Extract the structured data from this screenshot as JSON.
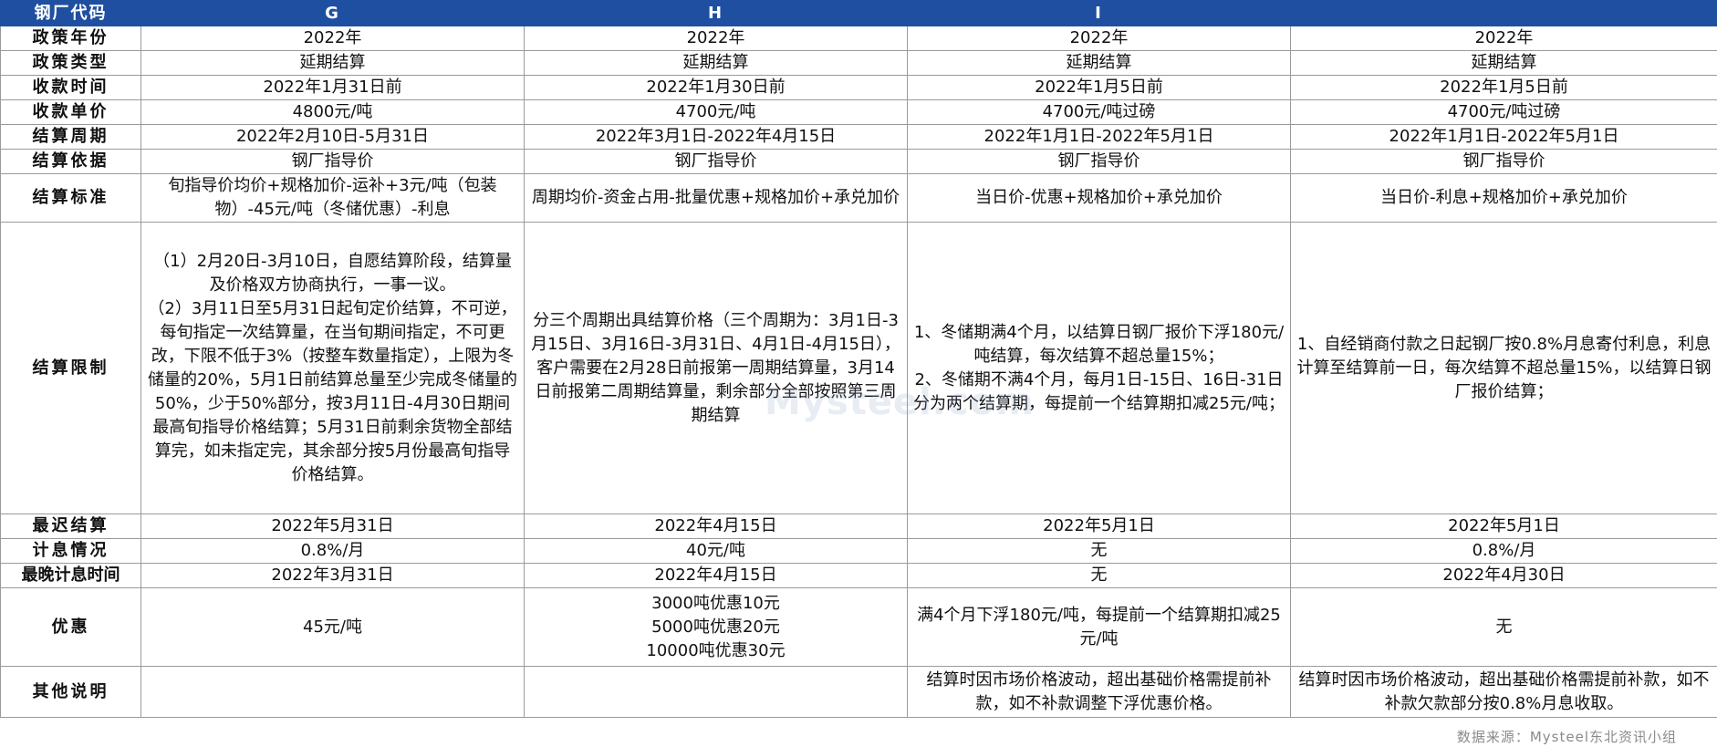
{
  "table": {
    "header": [
      "钢厂代码",
      "G",
      "H",
      "I",
      ""
    ],
    "rows": [
      {
        "label": "政策年份",
        "cells": [
          "2022年",
          "2022年",
          "2022年",
          "2022年"
        ]
      },
      {
        "label": "政策类型",
        "cells": [
          "延期结算",
          "延期结算",
          "延期结算",
          "延期结算"
        ]
      },
      {
        "label": "收款时间",
        "cells": [
          "2022年1月31日前",
          "2022年1月30日前",
          "2022年1月5日前",
          "2022年1月5日前"
        ]
      },
      {
        "label": "收款单价",
        "cells": [
          "4800元/吨",
          "4700元/吨",
          "4700元/吨过磅",
          "4700元/吨过磅"
        ]
      },
      {
        "label": "结算周期",
        "cells": [
          "2022年2月10日-5月31日",
          "2022年3月1日-2022年4月15日",
          "2022年1月1日-2022年5月1日",
          "2022年1月1日-2022年5月1日"
        ]
      },
      {
        "label": "结算依据",
        "cells": [
          "钢厂指导价",
          "钢厂指导价",
          "钢厂指导价",
          "钢厂指导价"
        ]
      },
      {
        "label": "结算标准",
        "cells": [
          "旬指导价均价+规格加价-运补+3元/吨（包装物）-45元/吨（冬储优惠）-利息",
          "周期均价-资金占用-批量优惠+规格加价+承兑加价",
          "当日价-优惠+规格加价+承兑加价",
          "当日价-利息+规格加价+承兑加价"
        ]
      },
      {
        "label": "结算限制",
        "cells": [
          "（1）2月20日-3月10日，自愿结算阶段，结算量及价格双方协商执行，一事一议。\n（2）3月11日至5月31日起旬定价结算，不可逆，每旬指定一次结算量，在当旬期间指定，不可更改，下限不低于3%（按整车数量指定），上限为冬储量的20%，5月1日前结算总量至少完成冬储量的50%，少于50%部分，按3月11日-4月30日期间最高旬指导价格结算；5月31日前剩余货物全部结算完，如未指定完，其余部分按5月份最高旬指导价格结算。",
          "分三个周期出具结算价格（三个周期为：3月1日-3月15日、3月16日-3月31日、4月1日-4月15日），客户需要在2月28日前报第一周期结算量，3月14日前报第二周期结算量，剩余部分全部按照第三周期结算",
          "1、冬储期满4个月，以结算日钢厂报价下浮180元/吨结算，每次结算不超总量15%；\n2、冬储期不满4个月，每月1日-15日、16日-31日分为两个结算期，每提前一个结算期扣减25元/吨；",
          "1、自经销商付款之日起钢厂按0.8%月息寄付利息，利息计算至结算前一日，每次结算不超总量15%，以结算日钢厂报价结算；"
        ]
      },
      {
        "label": "最迟结算",
        "cells": [
          "2022年5月31日",
          "2022年4月15日",
          "2022年5月1日",
          "2022年5月1日"
        ]
      },
      {
        "label": "计息情况",
        "cells": [
          "0.8%/月",
          "40元/吨",
          "无",
          "0.8%/月"
        ]
      },
      {
        "label": "最晚计息时间",
        "cells": [
          "2022年3月31日",
          "2022年4月15日",
          "无",
          "2022年4月30日"
        ]
      },
      {
        "label": "优惠",
        "cells": [
          "45元/吨",
          "3000吨优惠10元\n5000吨优惠20元\n10000吨优惠30元",
          "满4个月下浮180元/吨，每提前一个结算期扣减25元/吨",
          "无"
        ]
      },
      {
        "label": "其他说明",
        "cells": [
          "",
          "",
          "结算时因市场价格波动，超出基础价格需提前补款，如不补款调整下浮优惠价格。",
          "结算时因市场价格波动，超出基础价格需提前补款，如不补款欠款部分按0.8%月息收取。"
        ]
      }
    ]
  },
  "source": "数据来源：Mysteel东北资讯小组",
  "watermark": "Mysteel.com",
  "colors": {
    "header_bg": "#1f4fa0",
    "header_text": "#ffffff",
    "border": "#9a9a9a"
  }
}
